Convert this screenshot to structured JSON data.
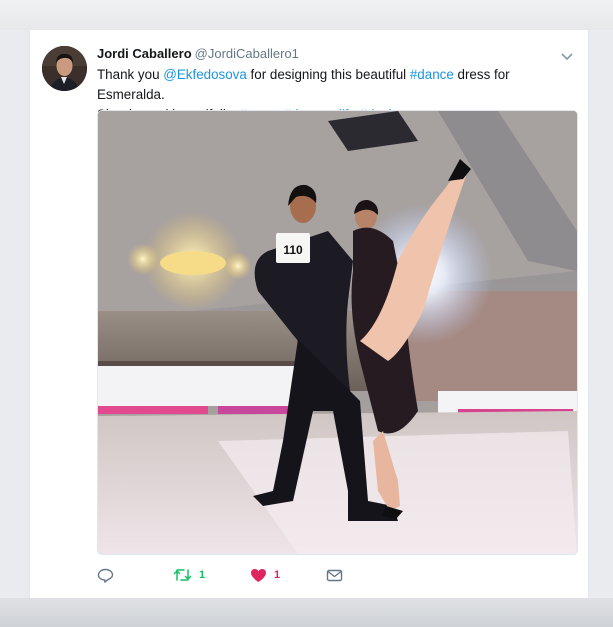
{
  "tweet": {
    "author_name": "Jordi Caballero",
    "author_handle": "@JordiCaballero1",
    "text": {
      "t1": "Thank you ",
      "mention": "@Ekfedosova",
      "t2": " for designing this beautiful ",
      "tag_dance": "#dance",
      "t3": " dress for Esmeralda.",
      "t4": "She danced beautifully. ",
      "tag_tango": "#tango",
      "sp1": " ",
      "tag_dancerslife": "#dancerslife",
      "sp2": " ",
      "tag_design": "#design"
    },
    "photo": {
      "bib_number": "110"
    },
    "actions": {
      "reply_icon": "reply-icon",
      "retweet_icon": "retweet-icon",
      "retweet_count": "1",
      "like_icon": "heart-icon",
      "like_count": "1",
      "dm_icon": "envelope-icon"
    }
  },
  "colors": {
    "link": "#1b95e0",
    "retweet": "#17bf63",
    "like": "#e0245e",
    "muted": "#657786"
  }
}
